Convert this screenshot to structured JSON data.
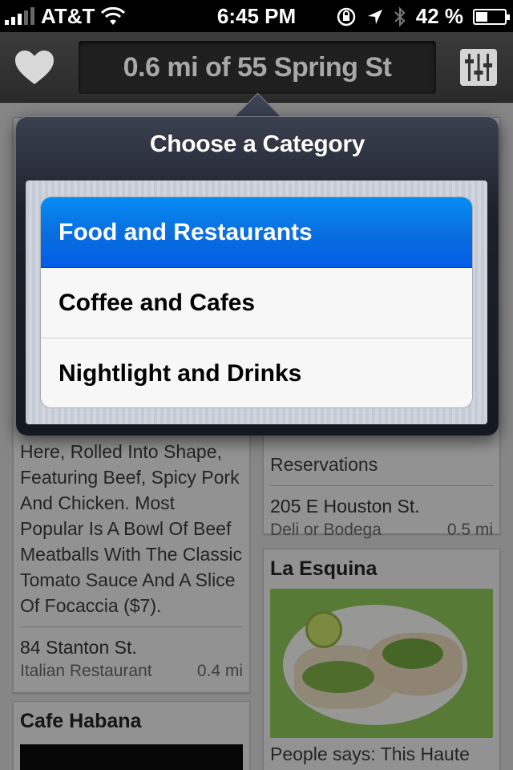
{
  "status_bar": {
    "carrier": "AT&T",
    "time": "6:45 PM",
    "battery": "42 %",
    "battery_level": 0.42
  },
  "navbar": {
    "location": "0.6 mi of 55 Spring St",
    "favorites_icon": "heart-icon",
    "filter_icon": "sliders-icon"
  },
  "cards": {
    "left_top": {
      "body": "Here, Rolled Into Shape, Featuring Beef, Spicy Pork And Chicken. Most Popular Is A Bowl Of Beef Meatballs With The Classic Tomato Sauce And A Slice Of Focaccia ($7).",
      "address": "84 Stanton St.",
      "category": "Italian Restaurant",
      "distance": "0.4 mi"
    },
    "right_top": {
      "body": "Reservations",
      "address": "205 E Houston St.",
      "category": "Deli or Bodega",
      "distance": "0.5 mi"
    },
    "left_bottom": {
      "title": "Cafe Habana"
    },
    "right_bottom": {
      "title": "La Esquina",
      "caption": "People says: This Haute"
    }
  },
  "popover": {
    "title": "Choose a Category",
    "items": [
      {
        "label": "Food and Restaurants",
        "selected": true
      },
      {
        "label": "Coffee and Cafes",
        "selected": false
      },
      {
        "label": "Nightlight and Drinks",
        "selected": false
      }
    ]
  },
  "colors": {
    "selected_blue": "#0a6fe0",
    "popover_dark": "#1d212b"
  }
}
